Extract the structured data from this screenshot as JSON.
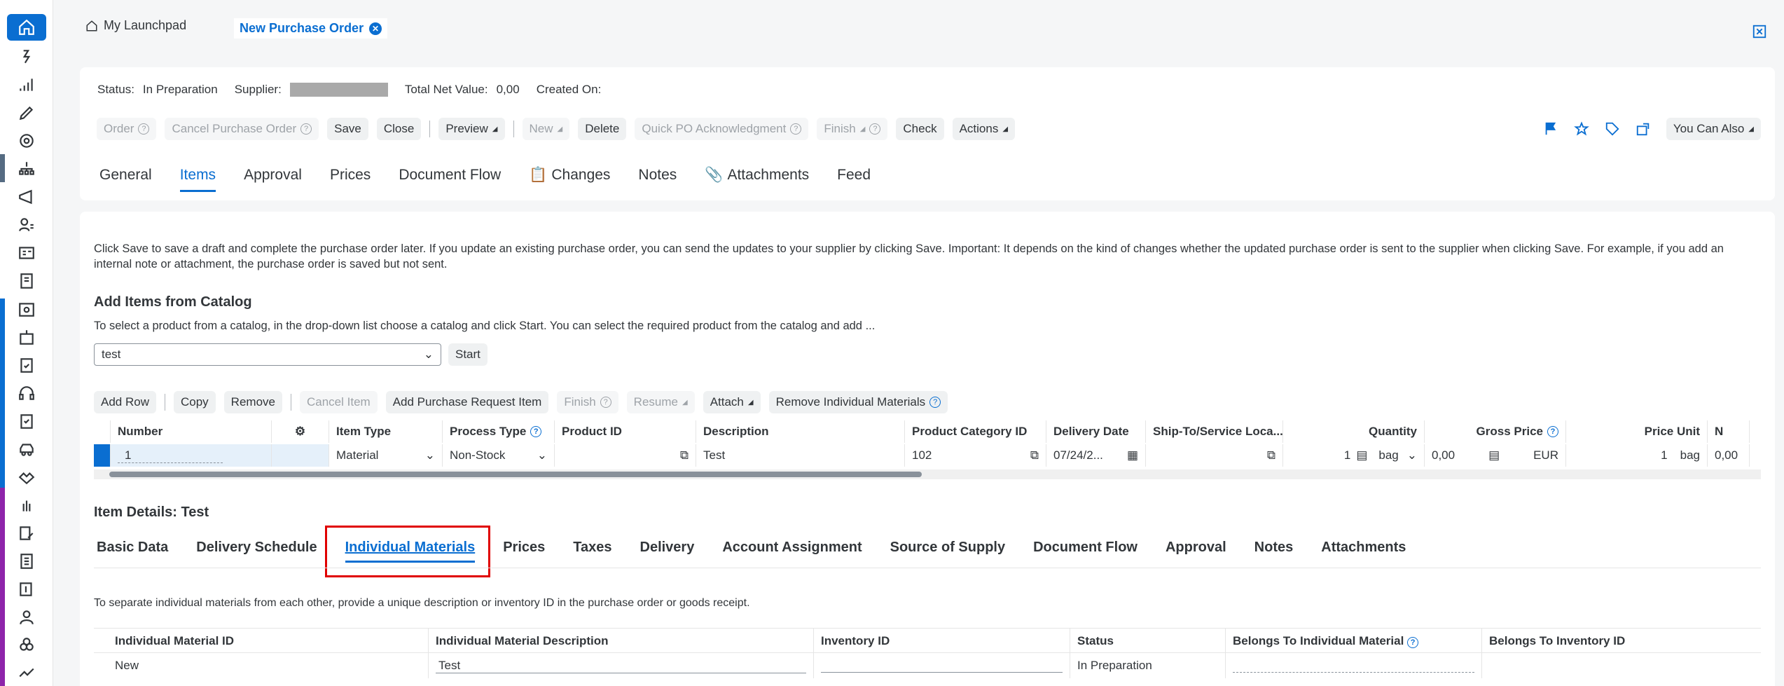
{
  "shell": {
    "launchpad_label": "My Launchpad",
    "active_tab_label": "New Purchase Order"
  },
  "header": {
    "status_label": "Status:",
    "status_value": "In Preparation",
    "supplier_label": "Supplier:",
    "total_net_label": "Total Net Value:",
    "total_net_value": "0,00",
    "created_on_label": "Created On:",
    "toolbar": {
      "order": "Order",
      "cancel": "Cancel Purchase Order",
      "save": "Save",
      "close": "Close",
      "preview": "Preview",
      "new": "New",
      "delete": "Delete",
      "quick_ack": "Quick PO Acknowledgment",
      "finish": "Finish",
      "check": "Check",
      "actions": "Actions",
      "you_can_also": "You Can Also"
    },
    "tabs": [
      "General",
      "Items",
      "Approval",
      "Prices",
      "Document Flow",
      "Changes",
      "Notes",
      "Attachments",
      "Feed"
    ]
  },
  "content": {
    "info_text": "Click Save to save a draft and complete the purchase order later. If you update an existing purchase order, you can send the updates to your supplier by clicking Save. Important: It depends on the kind of changes whether the updated purchase order is sent to the supplier when clicking Save. For example, if you add an internal note or attachment, the purchase order is saved but not sent.",
    "catalog_title": "Add Items from Catalog",
    "catalog_hint": "To select a product from a catalog, in the drop-down list choose a catalog and click Start. You can select the required product from the catalog and add ...",
    "catalog_value": "test",
    "start_label": "Start",
    "item_toolbar": {
      "add_row": "Add Row",
      "copy": "Copy",
      "remove": "Remove",
      "cancel_item": "Cancel Item",
      "add_pr_item": "Add Purchase Request Item",
      "finish": "Finish",
      "resume": "Resume",
      "attach": "Attach",
      "remove_im": "Remove Individual Materials"
    },
    "items_table": {
      "headers": {
        "number": "Number",
        "item_type": "Item Type",
        "process_type": "Process Type",
        "product_id": "Product ID",
        "description": "Description",
        "product_category": "Product Category ID",
        "delivery_date": "Delivery Date",
        "ship_to": "Ship-To/Service Loca...",
        "quantity": "Quantity",
        "gross_price": "Gross Price",
        "price_unit": "Price Unit",
        "next": "N"
      },
      "row": {
        "number": "1",
        "item_type": "Material",
        "process_type": "Non-Stock",
        "product_id": "",
        "description": "Test",
        "product_category": "102",
        "delivery_date": "07/24/2...",
        "quantity": "1",
        "unit": "bag",
        "gross_price": "0,00",
        "currency": "EUR",
        "price_unit": "1",
        "price_unit_uom": "bag",
        "net": "0,00"
      }
    },
    "item_details_title": "Item Details: Test",
    "detail_tabs": [
      "Basic Data",
      "Delivery Schedule",
      "Individual Materials",
      "Prices",
      "Taxes",
      "Delivery",
      "Account Assignment",
      "Source of Supply",
      "Document Flow",
      "Approval",
      "Notes",
      "Attachments"
    ],
    "im_hint": "To separate individual materials from each other, provide a unique description or inventory ID in the purchase order or goods receipt.",
    "im_table": {
      "headers": [
        "Individual Material ID",
        "Individual Material Description",
        "Inventory ID",
        "Status",
        "Belongs To Individual Material",
        "Belongs To Inventory ID"
      ],
      "row": [
        "New",
        "Test",
        "",
        "In Preparation",
        "",
        ""
      ]
    }
  }
}
